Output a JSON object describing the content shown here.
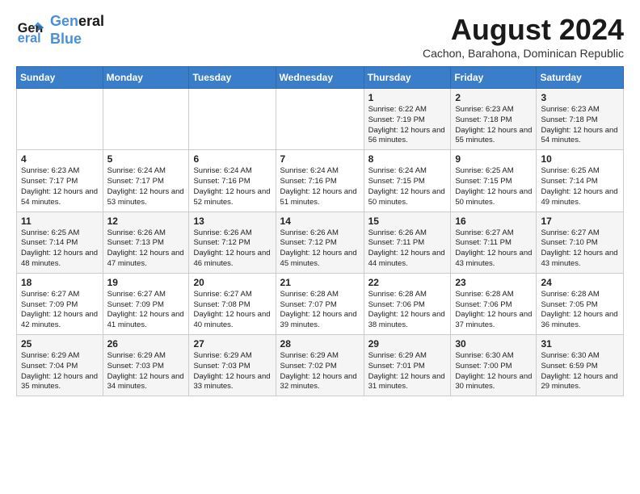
{
  "logo": {
    "line1": "General",
    "line2": "Blue"
  },
  "header": {
    "month": "August 2024",
    "location": "Cachon, Barahona, Dominican Republic"
  },
  "weekdays": [
    "Sunday",
    "Monday",
    "Tuesday",
    "Wednesday",
    "Thursday",
    "Friday",
    "Saturday"
  ],
  "weeks": [
    [
      {
        "day": "",
        "info": ""
      },
      {
        "day": "",
        "info": ""
      },
      {
        "day": "",
        "info": ""
      },
      {
        "day": "",
        "info": ""
      },
      {
        "day": "1",
        "info": "Sunrise: 6:22 AM\nSunset: 7:19 PM\nDaylight: 12 hours and 56 minutes."
      },
      {
        "day": "2",
        "info": "Sunrise: 6:23 AM\nSunset: 7:18 PM\nDaylight: 12 hours and 55 minutes."
      },
      {
        "day": "3",
        "info": "Sunrise: 6:23 AM\nSunset: 7:18 PM\nDaylight: 12 hours and 54 minutes."
      }
    ],
    [
      {
        "day": "4",
        "info": "Sunrise: 6:23 AM\nSunset: 7:17 PM\nDaylight: 12 hours and 54 minutes."
      },
      {
        "day": "5",
        "info": "Sunrise: 6:24 AM\nSunset: 7:17 PM\nDaylight: 12 hours and 53 minutes."
      },
      {
        "day": "6",
        "info": "Sunrise: 6:24 AM\nSunset: 7:16 PM\nDaylight: 12 hours and 52 minutes."
      },
      {
        "day": "7",
        "info": "Sunrise: 6:24 AM\nSunset: 7:16 PM\nDaylight: 12 hours and 51 minutes."
      },
      {
        "day": "8",
        "info": "Sunrise: 6:24 AM\nSunset: 7:15 PM\nDaylight: 12 hours and 50 minutes."
      },
      {
        "day": "9",
        "info": "Sunrise: 6:25 AM\nSunset: 7:15 PM\nDaylight: 12 hours and 50 minutes."
      },
      {
        "day": "10",
        "info": "Sunrise: 6:25 AM\nSunset: 7:14 PM\nDaylight: 12 hours and 49 minutes."
      }
    ],
    [
      {
        "day": "11",
        "info": "Sunrise: 6:25 AM\nSunset: 7:14 PM\nDaylight: 12 hours and 48 minutes."
      },
      {
        "day": "12",
        "info": "Sunrise: 6:26 AM\nSunset: 7:13 PM\nDaylight: 12 hours and 47 minutes."
      },
      {
        "day": "13",
        "info": "Sunrise: 6:26 AM\nSunset: 7:12 PM\nDaylight: 12 hours and 46 minutes."
      },
      {
        "day": "14",
        "info": "Sunrise: 6:26 AM\nSunset: 7:12 PM\nDaylight: 12 hours and 45 minutes."
      },
      {
        "day": "15",
        "info": "Sunrise: 6:26 AM\nSunset: 7:11 PM\nDaylight: 12 hours and 44 minutes."
      },
      {
        "day": "16",
        "info": "Sunrise: 6:27 AM\nSunset: 7:11 PM\nDaylight: 12 hours and 43 minutes."
      },
      {
        "day": "17",
        "info": "Sunrise: 6:27 AM\nSunset: 7:10 PM\nDaylight: 12 hours and 43 minutes."
      }
    ],
    [
      {
        "day": "18",
        "info": "Sunrise: 6:27 AM\nSunset: 7:09 PM\nDaylight: 12 hours and 42 minutes."
      },
      {
        "day": "19",
        "info": "Sunrise: 6:27 AM\nSunset: 7:09 PM\nDaylight: 12 hours and 41 minutes."
      },
      {
        "day": "20",
        "info": "Sunrise: 6:27 AM\nSunset: 7:08 PM\nDaylight: 12 hours and 40 minutes."
      },
      {
        "day": "21",
        "info": "Sunrise: 6:28 AM\nSunset: 7:07 PM\nDaylight: 12 hours and 39 minutes."
      },
      {
        "day": "22",
        "info": "Sunrise: 6:28 AM\nSunset: 7:06 PM\nDaylight: 12 hours and 38 minutes."
      },
      {
        "day": "23",
        "info": "Sunrise: 6:28 AM\nSunset: 7:06 PM\nDaylight: 12 hours and 37 minutes."
      },
      {
        "day": "24",
        "info": "Sunrise: 6:28 AM\nSunset: 7:05 PM\nDaylight: 12 hours and 36 minutes."
      }
    ],
    [
      {
        "day": "25",
        "info": "Sunrise: 6:29 AM\nSunset: 7:04 PM\nDaylight: 12 hours and 35 minutes."
      },
      {
        "day": "26",
        "info": "Sunrise: 6:29 AM\nSunset: 7:03 PM\nDaylight: 12 hours and 34 minutes."
      },
      {
        "day": "27",
        "info": "Sunrise: 6:29 AM\nSunset: 7:03 PM\nDaylight: 12 hours and 33 minutes."
      },
      {
        "day": "28",
        "info": "Sunrise: 6:29 AM\nSunset: 7:02 PM\nDaylight: 12 hours and 32 minutes."
      },
      {
        "day": "29",
        "info": "Sunrise: 6:29 AM\nSunset: 7:01 PM\nDaylight: 12 hours and 31 minutes."
      },
      {
        "day": "30",
        "info": "Sunrise: 6:30 AM\nSunset: 7:00 PM\nDaylight: 12 hours and 30 minutes."
      },
      {
        "day": "31",
        "info": "Sunrise: 6:30 AM\nSunset: 6:59 PM\nDaylight: 12 hours and 29 minutes."
      }
    ]
  ]
}
